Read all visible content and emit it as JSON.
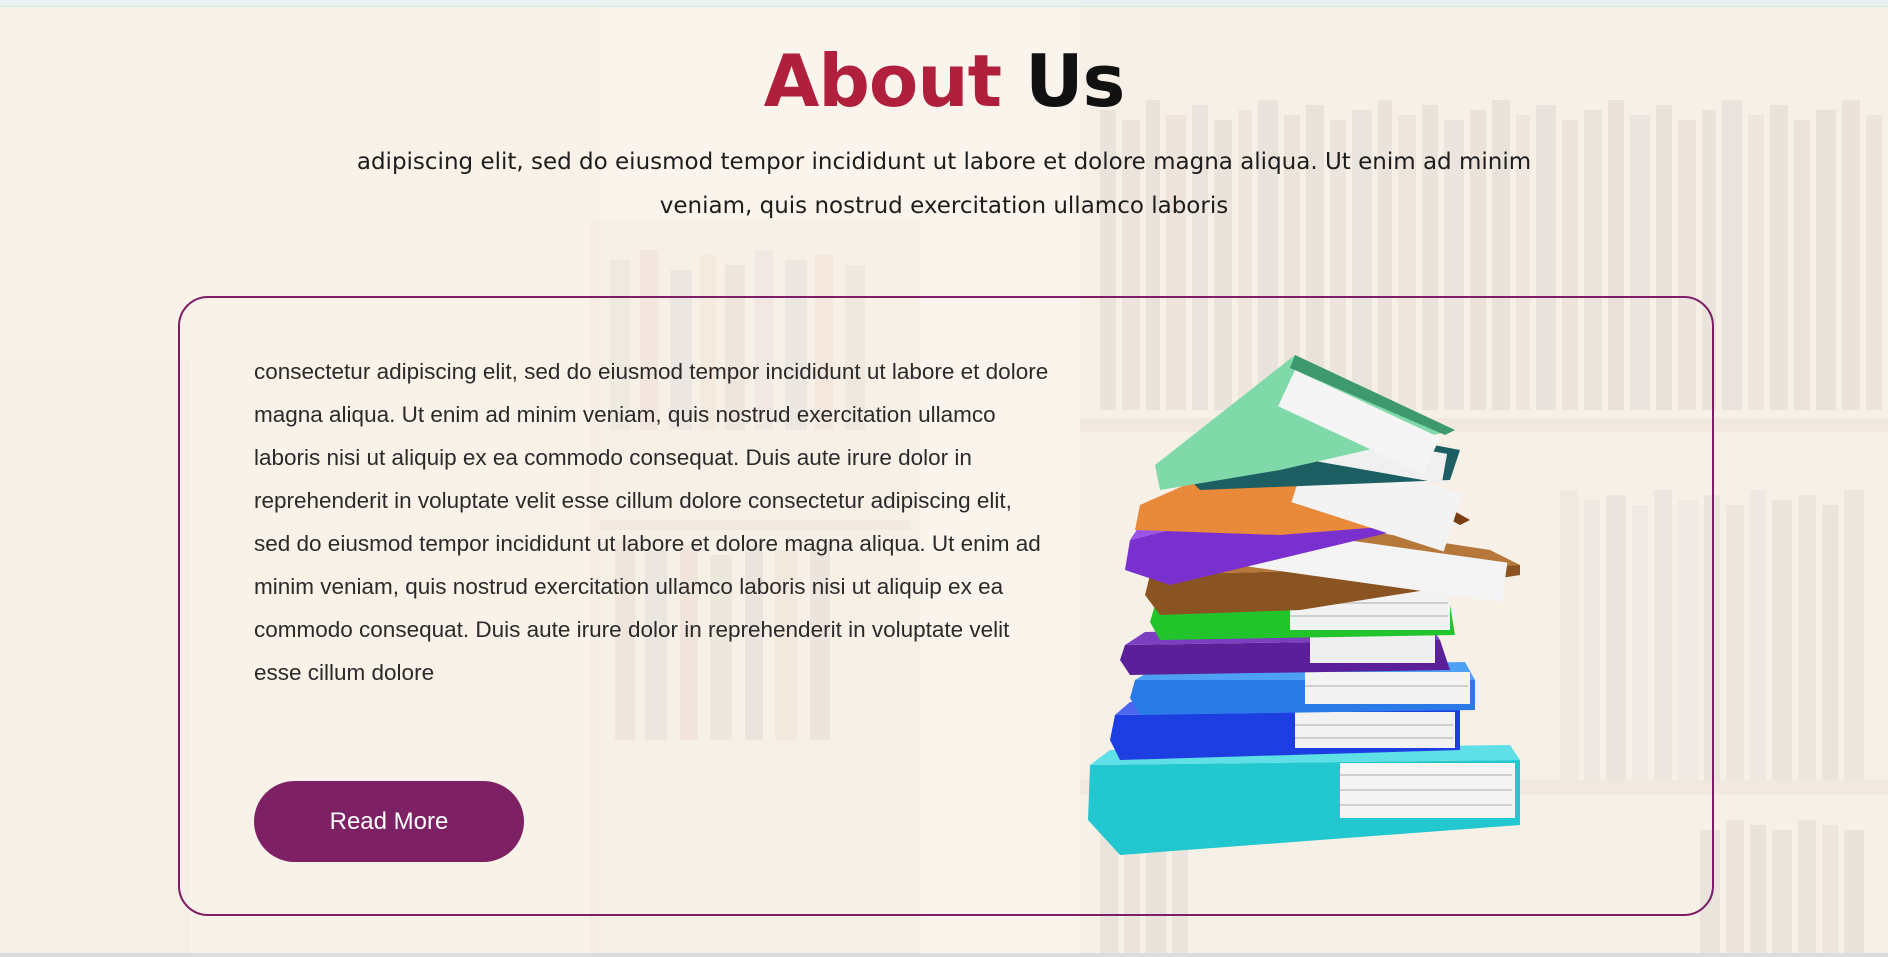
{
  "about": {
    "title_accent": "About",
    "title_rest": "Us",
    "intro": "adipiscing elit, sed do eiusmod tempor incididunt ut labore et dolore magna aliqua. Ut enim ad minim veniam, quis nostrud exercitation ullamco laboris",
    "body": "consectetur adipiscing elit, sed do eiusmod tempor incididunt ut labore et dolore magna aliqua. Ut enim ad minim veniam, quis nostrud exercitation ullamco laboris nisi ut aliquip ex ea commodo consequat. Duis aute irure dolor in reprehenderit in voluptate velit esse cillum dolore consectetur adipiscing elit, sed do eiusmod tempor incididunt ut labore et dolore magna aliqua. Ut enim ad minim veniam, quis nostrud exercitation ullamco laboris nisi ut aliquip ex ea commodo consequat. Duis aute irure dolor in reprehenderit in voluptate velit esse cillum dolore",
    "button_label": "Read More"
  },
  "colors": {
    "accent_red": "#b01f3c",
    "button_purple": "#7e2164",
    "card_border": "#7d1f66"
  },
  "image": {
    "icon": "stack-of-books-icon"
  }
}
